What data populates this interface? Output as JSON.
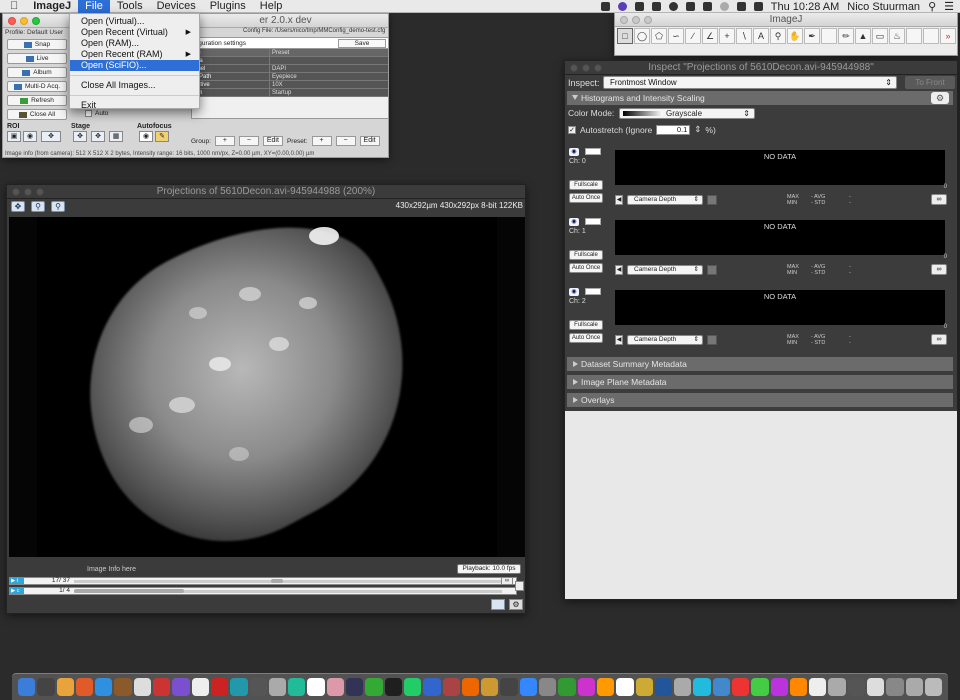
{
  "menubar": {
    "apple": "",
    "app": "ImageJ",
    "items": [
      "File",
      "Tools",
      "Devices",
      "Plugins",
      "Help"
    ],
    "clock": "Thu 10:28 AM",
    "user": "Nico Stuurman"
  },
  "file_menu": {
    "items": [
      {
        "label": "Open (Virtual)..."
      },
      {
        "label": "Open Recent (Virtual)",
        "submenu": true
      },
      {
        "label": "Open (RAM)..."
      },
      {
        "label": "Open Recent (RAM)",
        "submenu": true
      },
      {
        "label": "Open (SciFIO)...",
        "selected": true
      },
      {
        "label": "Close All Images..."
      },
      {
        "label": "Exit"
      }
    ]
  },
  "mm": {
    "title": "er 2.0.x dev",
    "profile": "Profile: Default User",
    "config_file": "Config File: /Users/nico/tmp/MMConfig_demo-test.cfg",
    "config_header": "figuration settings",
    "save": "Save",
    "buttons": [
      "Snap",
      "Live",
      "Album",
      "Multi-D Acq.",
      "Refresh",
      "Close All"
    ],
    "preset_hdr": [
      "up",
      "Preset"
    ],
    "rows": [
      {
        "k": "era",
        "v": ""
      },
      {
        "k": "nnel",
        "v": "DAPI"
      },
      {
        "k": "ptPath",
        "v": "Eyepiece"
      },
      {
        "k": "ective",
        "v": "10X"
      },
      {
        "k": "em",
        "v": "Startup"
      }
    ],
    "auto_label": "Auto",
    "roi": "ROI",
    "stage": "Stage",
    "autofocus": "Autofocus",
    "group": "Group:",
    "preset": "Preset:",
    "edit": "Edit",
    "plus": "+",
    "minus": "−",
    "status": "Image info (from camera): 512 X 512 X 2 bytes, Intensity range: 16 bits, 1000 nm/px, Z=0.00 µm, XY=(0.00,0.00) µm"
  },
  "image_window": {
    "title": "Projections of 5610Decon.avi-945944988 (200%)",
    "info": "430x292µm  430x292px  8-bit 122KB",
    "image_info": "Image Info here",
    "playback": "Playback: 10.0 fps",
    "axes": [
      {
        "name": "t",
        "value": "17/  37",
        "position": 0.46
      },
      {
        "name": "c",
        "value": "1/   4",
        "position": 0.0
      }
    ]
  },
  "imagej": {
    "title": "ImageJ",
    "tools": [
      "rect",
      "oval",
      "poly",
      "freehand",
      "line",
      "angle",
      "point",
      "wand",
      "text",
      "zoom",
      "hand",
      "dropper",
      "",
      "pencil",
      "stamp",
      "eraser",
      "flood",
      "",
      "",
      "more"
    ]
  },
  "inspector": {
    "title": "Inspect \"Projections of 5610Decon.avi-945944988\"",
    "inspect_label": "Inspect:",
    "inspect_value": "Frontmost Window",
    "to_front": "To Front",
    "histograms": "Histograms and Intensity Scaling",
    "color_mode_label": "Color Mode:",
    "color_mode": "Grayscale",
    "autostretch": "Autostretch  (Ignore",
    "ignore_value": "0.1",
    "percent": "%)",
    "channels": [
      {
        "name": "Ch: 0",
        "hist": "NO DATA",
        "zero": "0",
        "mode": "Camera Depth",
        "max": "MAX",
        "avg": "- AVG",
        "min": "MIN",
        "std": "- STD",
        "dash": "-"
      },
      {
        "name": "Ch: 1",
        "hist": "NO DATA",
        "zero": "0",
        "mode": "Camera Depth",
        "max": "MAX",
        "avg": "- AVG",
        "min": "MIN",
        "std": "- STD",
        "dash": "-"
      },
      {
        "name": "Ch: 2",
        "hist": "NO DATA",
        "zero": "0",
        "mode": "Camera Depth",
        "max": "MAX",
        "avg": "- AVG",
        "min": "MIN",
        "std": "- STD",
        "dash": "-"
      }
    ],
    "fullscale": "Fullscale",
    "auto_once": "Auto Once",
    "sections": [
      "Dataset Summary Metadata",
      "Image Plane Metadata",
      "Overlays"
    ]
  },
  "dock": {
    "count": 48
  }
}
